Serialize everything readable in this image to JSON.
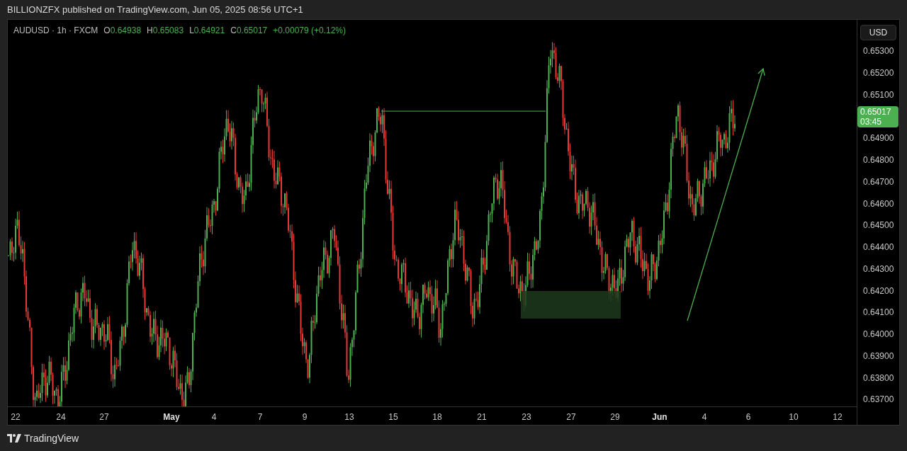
{
  "header": {
    "title": "BILLIONZFX published on TradingView.com, Jun 05, 2025 08:56 UTC+1"
  },
  "legend": {
    "symbol": "AUDUSD · 1h · FXCM",
    "ohlc": [
      {
        "label": "O",
        "value": "0.64938"
      },
      {
        "label": "H",
        "value": "0.65083"
      },
      {
        "label": "L",
        "value": "0.64921"
      },
      {
        "label": "C",
        "value": "0.65017"
      }
    ],
    "change": "+0.00079 (+0.12%)"
  },
  "price_axis": {
    "unit": "USD",
    "slots": [
      {
        "kind": "tick",
        "label": "0.65300"
      },
      {
        "kind": "tick",
        "label": "0.65200"
      },
      {
        "kind": "tick",
        "label": "0.65100"
      },
      {
        "kind": "badge",
        "price": "0.65017",
        "countdown": "03:45"
      },
      {
        "kind": "tick",
        "label": "0.64900"
      },
      {
        "kind": "tick",
        "label": "0.64800"
      },
      {
        "kind": "tick",
        "label": "0.64700"
      },
      {
        "kind": "tick",
        "label": "0.64600"
      },
      {
        "kind": "tick",
        "label": "0.64500"
      },
      {
        "kind": "tick",
        "label": "0.64400"
      },
      {
        "kind": "tick",
        "label": "0.64300"
      },
      {
        "kind": "tick",
        "label": "0.64200"
      },
      {
        "kind": "tick",
        "label": "0.64100"
      },
      {
        "kind": "tick",
        "label": "0.64000"
      },
      {
        "kind": "tick",
        "label": "0.63900"
      },
      {
        "kind": "tick",
        "label": "0.63800"
      },
      {
        "kind": "tick",
        "label": "0.63700"
      }
    ]
  },
  "time_axis": {
    "labels": [
      {
        "label": "22",
        "kind": "day"
      },
      {
        "label": "24",
        "kind": "day"
      },
      {
        "label": "27",
        "kind": "day"
      },
      {
        "label": "May",
        "kind": "month"
      },
      {
        "label": "4",
        "kind": "day"
      },
      {
        "label": "7",
        "kind": "day"
      },
      {
        "label": "9",
        "kind": "day"
      },
      {
        "label": "13",
        "kind": "day"
      },
      {
        "label": "15",
        "kind": "day"
      },
      {
        "label": "18",
        "kind": "day"
      },
      {
        "label": "21",
        "kind": "day"
      },
      {
        "label": "23",
        "kind": "day"
      },
      {
        "label": "27",
        "kind": "day"
      },
      {
        "label": "29",
        "kind": "day"
      },
      {
        "label": "Jun",
        "kind": "month"
      },
      {
        "label": "4",
        "kind": "day"
      },
      {
        "label": "6",
        "kind": "day"
      },
      {
        "label": "10",
        "kind": "day"
      },
      {
        "label": "12",
        "kind": "day"
      }
    ]
  },
  "footer": {
    "brand": "TradingView"
  }
}
